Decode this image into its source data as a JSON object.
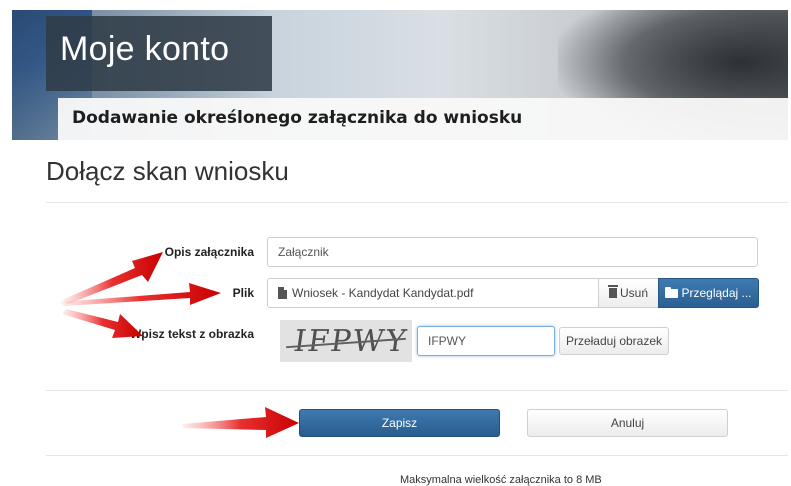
{
  "header": {
    "title": "Moje konto",
    "subtitle": "Dodawanie określonego załącznika do wniosku"
  },
  "section": {
    "title": "Dołącz skan wniosku"
  },
  "form": {
    "description": {
      "label": "Opis załącznika",
      "value": "Załącznik"
    },
    "file": {
      "label": "Plik",
      "file_name": "Wniosek - Kandydat Kandydat.pdf",
      "remove_label": "Usuń",
      "browse_label": "Przeglądaj ..."
    },
    "captcha": {
      "label": "Wpisz tekst z obrazka",
      "image_text": "IFPWY",
      "value": "IFPWY",
      "reload_label": "Przeładuj obrazek"
    }
  },
  "actions": {
    "save_label": "Zapisz",
    "cancel_label": "Anuluj"
  },
  "footer": {
    "note": "Maksymalna wielkość załącznika to 8 MB"
  },
  "colors": {
    "primary_button": "#2f6aa0",
    "annotation_arrow": "#e02020"
  }
}
